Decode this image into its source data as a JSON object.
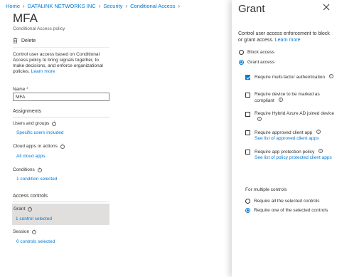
{
  "breadcrumb": [
    "Home",
    "DATALINK NETWORKS INC",
    "Security",
    "Conditional Access"
  ],
  "page": {
    "title": "MFA",
    "subtitle": "Conditional Access policy"
  },
  "toolbar": {
    "delete_label": "Delete"
  },
  "description": {
    "text": "Control user access based on Conditional Access policy to bring signals together, to make decisions, and enforce organizational policies.",
    "link": "Learn more"
  },
  "name_field": {
    "label": "Name",
    "required_mark": "*",
    "value": "MFA"
  },
  "assignments": {
    "heading": "Assignments",
    "users": {
      "label": "Users and groups",
      "value": "Specific users included"
    },
    "cloud_apps": {
      "label": "Cloud apps or actions",
      "value": "All cloud apps"
    },
    "conditions": {
      "label": "Conditions",
      "value": "1 condition selected"
    }
  },
  "access_controls": {
    "heading": "Access controls",
    "grant": {
      "label": "Grant",
      "value": "1 control selected"
    },
    "session": {
      "label": "Session",
      "value": "0 controls selected"
    }
  },
  "grant_panel": {
    "title": "Grant",
    "description": "Control user access enforcement to block or grant access.",
    "link": "Learn more",
    "block_access": "Block access",
    "grant_access": "Grant access",
    "selected_access": "grant",
    "controls": [
      {
        "label": "Require multi-factor authentication",
        "checked": true,
        "sublink": ""
      },
      {
        "label": "Require device to be marked as compliant",
        "checked": false,
        "sublink": ""
      },
      {
        "label": "Require Hybrid Azure AD joined device",
        "checked": false,
        "sublink": ""
      },
      {
        "label": "Require approved client app",
        "checked": false,
        "sublink": "See list of approved client apps"
      },
      {
        "label": "Require app protection policy",
        "checked": false,
        "sublink": "See list of policy protected client apps"
      }
    ],
    "multiple_controls": {
      "label": "For multiple controls",
      "require_all": "Require all the selected controls",
      "require_one": "Require one of the selected controls",
      "selected": "one"
    }
  },
  "colors": {
    "accent": "#0078d4",
    "selected_row": "#e1dfdd",
    "text": "#323130"
  }
}
